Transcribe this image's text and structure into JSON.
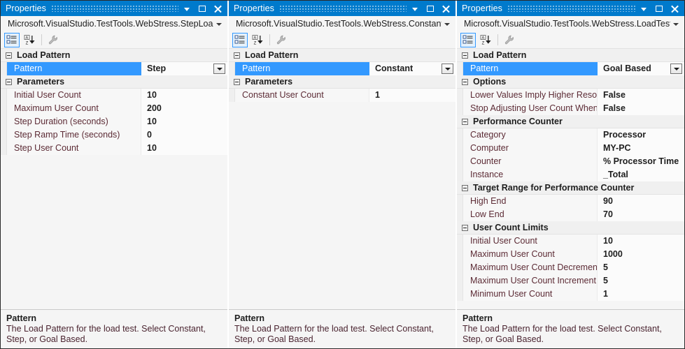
{
  "window": {
    "title": "Properties",
    "controls": {
      "dropdown": "chevron-down-icon",
      "maximize": "maximize-icon",
      "close": "close-icon"
    }
  },
  "toolbar": {
    "categorized": "categorized-view-icon",
    "alphabetical": "alphabetical-sort-icon",
    "property_pages": "property-pages-wrench-icon"
  },
  "panels": [
    {
      "object_selector": "Microsoft.VisualStudio.TestTools.WebStress.StepLoadPro",
      "groups": [
        {
          "label": "Load Pattern",
          "rows": [
            {
              "name": "Pattern",
              "value": "Step",
              "selected": true,
              "dropdown": true
            }
          ]
        },
        {
          "label": "Parameters",
          "rows": [
            {
              "name": "Initial User Count",
              "value": "10"
            },
            {
              "name": "Maximum User Count",
              "value": "200"
            },
            {
              "name": "Step Duration (seconds)",
              "value": "10"
            },
            {
              "name": "Step Ramp Time (seconds)",
              "value": "0"
            },
            {
              "name": "Step User Count",
              "value": "10"
            }
          ]
        }
      ],
      "description": {
        "title": "Pattern",
        "body": "The Load Pattern for the load test. Select Constant, Step, or Goal  Based."
      }
    },
    {
      "object_selector": "Microsoft.VisualStudio.TestTools.WebStress.ConstantLoa",
      "groups": [
        {
          "label": "Load Pattern",
          "rows": [
            {
              "name": "Pattern",
              "value": "Constant",
              "selected": true,
              "dropdown": true
            }
          ]
        },
        {
          "label": "Parameters",
          "rows": [
            {
              "name": "Constant User Count",
              "value": "1"
            }
          ]
        }
      ],
      "description": {
        "title": "Pattern",
        "body": "The Load Pattern for the load test. Select Constant, Step, or Goal  Based."
      }
    },
    {
      "object_selector": "Microsoft.VisualStudio.TestTools.WebStress.LoadTestGo",
      "groups": [
        {
          "label": "Load Pattern",
          "rows": [
            {
              "name": "Pattern",
              "value": "Goal Based",
              "selected": true,
              "dropdown": true
            }
          ]
        },
        {
          "label": "Options",
          "rows": [
            {
              "name": "Lower Values Imply Higher Resour",
              "value": "False"
            },
            {
              "name": "Stop Adjusting User Count When (",
              "value": "False"
            }
          ]
        },
        {
          "label": "Performance Counter",
          "rows": [
            {
              "name": "Category",
              "value": "Processor"
            },
            {
              "name": "Computer",
              "value": "MY-PC"
            },
            {
              "name": "Counter",
              "value": "% Processor Time"
            },
            {
              "name": "Instance",
              "value": "_Total"
            }
          ]
        },
        {
          "label": "Target Range for Performance Counter",
          "rows": [
            {
              "name": "High End",
              "value": "90"
            },
            {
              "name": "Low End",
              "value": "70"
            }
          ]
        },
        {
          "label": "User Count Limits",
          "rows": [
            {
              "name": "Initial User Count",
              "value": "10"
            },
            {
              "name": "Maximum User Count",
              "value": "1000"
            },
            {
              "name": "Maximum User Count Decrement",
              "value": "5"
            },
            {
              "name": "Maximum User Count Increment",
              "value": "5"
            },
            {
              "name": "Minimum User Count",
              "value": "1"
            }
          ]
        }
      ],
      "description": {
        "title": "Pattern",
        "body": "The Load Pattern for the load test. Select Constant, Step, or Goal  Based."
      }
    }
  ],
  "colors": {
    "titlebar": "#007acc",
    "selection": "#3399ff",
    "property_name": "#5c2b35",
    "panel_bg": "#f5f5f5"
  }
}
